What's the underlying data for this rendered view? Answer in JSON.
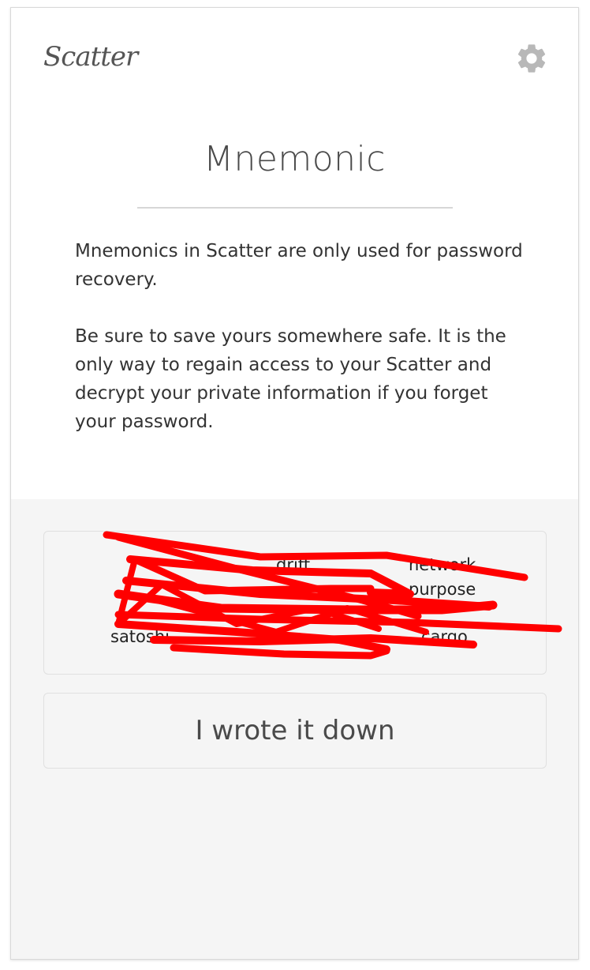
{
  "app": {
    "logo_text": "Scatter",
    "settings_icon": "gear-icon"
  },
  "main": {
    "title": "Mnemonic",
    "paragraph_1": "Mnemonics in Scatter are only used for password recovery.",
    "paragraph_2": "Be sure to save yours somewhere safe. It is the only way to regain access to your Scatter and decrypt your private information if you forget your password."
  },
  "mnemonic": {
    "visible_words": [
      "drift",
      "network",
      "purpose",
      "satoshi",
      "cargo"
    ],
    "redaction_color": "#ff0000"
  },
  "actions": {
    "confirm_label": "I wrote it down"
  },
  "colors": {
    "background_top": "#ffffff",
    "background_bottom": "#f5f5f5",
    "text": "#333333",
    "border": "#e0e0e0"
  }
}
